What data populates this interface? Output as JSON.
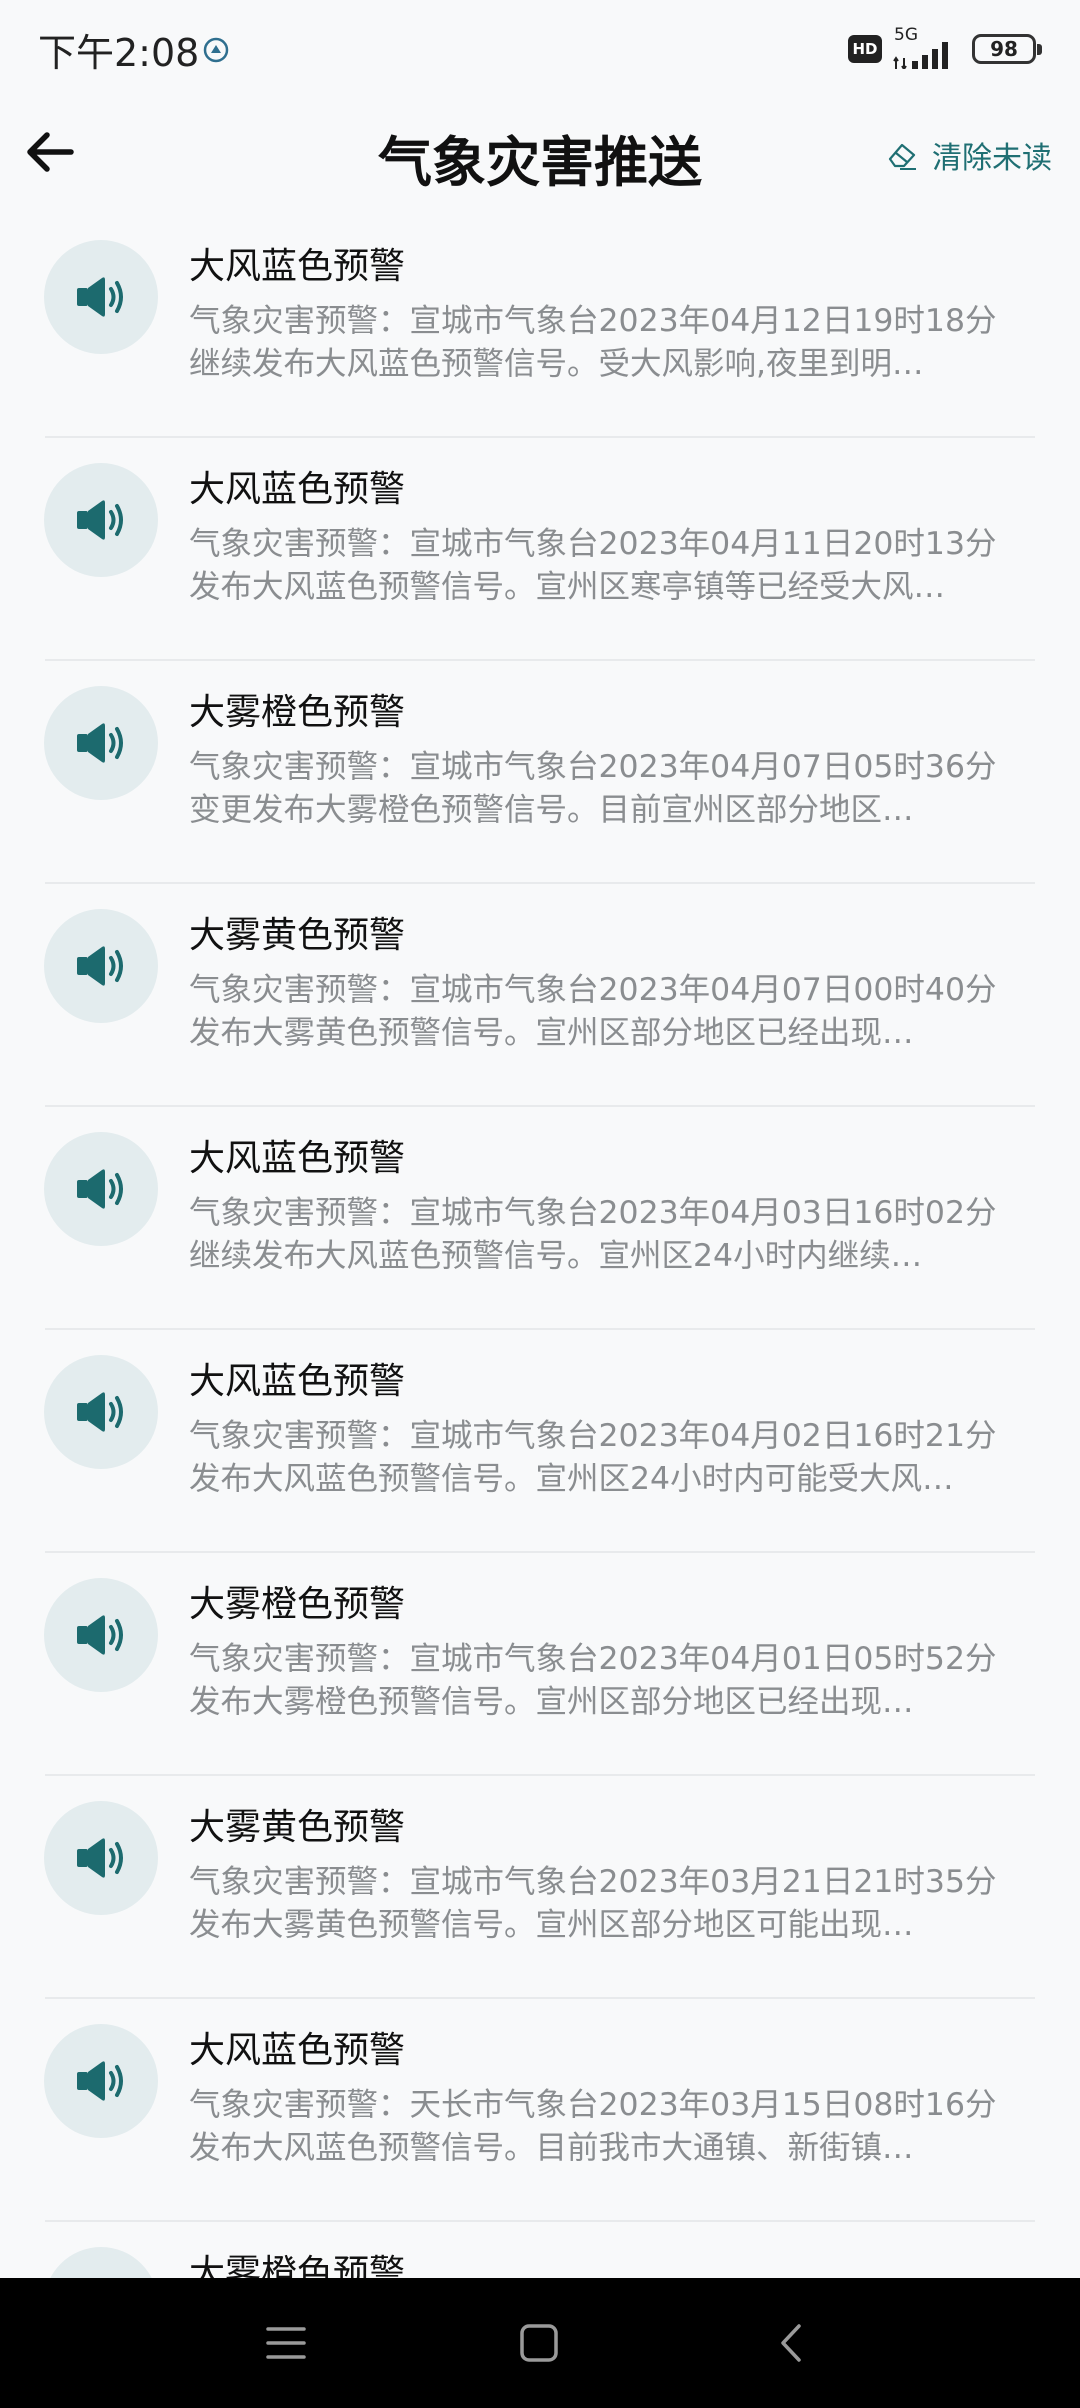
{
  "status_bar": {
    "time": "下午2:08",
    "hd_label": "HD",
    "network": "5G",
    "battery": "98"
  },
  "header": {
    "title": "气象灾害推送",
    "clear_unread_label": "清除未读"
  },
  "alerts": [
    {
      "title": "大风蓝色预警",
      "body": "气象灾害预警：宣城市气象台2023年04月12日19时18分继续发布大风蓝色预警信号。受大风影响,夜里到明…"
    },
    {
      "title": "大风蓝色预警",
      "body": "气象灾害预警：宣城市气象台2023年04月11日20时13分发布大风蓝色预警信号。宣州区寒亭镇等已经受大风…"
    },
    {
      "title": "大雾橙色预警",
      "body": "气象灾害预警：宣城市气象台2023年04月07日05时36分变更发布大雾橙色预警信号。目前宣州区部分地区…"
    },
    {
      "title": "大雾黄色预警",
      "body": "气象灾害预警：宣城市气象台2023年04月07日00时40分发布大雾黄色预警信号。宣州区部分地区已经出现…"
    },
    {
      "title": "大风蓝色预警",
      "body": "气象灾害预警：宣城市气象台2023年04月03日16时02分继续发布大风蓝色预警信号。宣州区24小时内继续…"
    },
    {
      "title": "大风蓝色预警",
      "body": "气象灾害预警：宣城市气象台2023年04月02日16时21分发布大风蓝色预警信号。宣州区24小时内可能受大风…"
    },
    {
      "title": "大雾橙色预警",
      "body": "气象灾害预警：宣城市气象台2023年04月01日05时52分发布大雾橙色预警信号。宣州区部分地区已经出现…"
    },
    {
      "title": "大雾黄色预警",
      "body": "气象灾害预警：宣城市气象台2023年03月21日21时35分发布大雾黄色预警信号。宣州区部分地区可能出现…"
    },
    {
      "title": "大风蓝色预警",
      "body": "气象灾害预警：天长市气象台2023年03月15日08时16分发布大风蓝色预警信号。目前我市大通镇、新街镇…"
    },
    {
      "title": "大雾橙色预警",
      "body": ""
    }
  ],
  "icons": {
    "alert_icon": "speaker-icon",
    "back": "arrow-left-icon",
    "clear": "eraser-icon",
    "nav_menu": "menu-icon",
    "nav_home": "home-icon",
    "nav_back": "chevron-left-icon"
  },
  "colors": {
    "accent": "#1f6f73",
    "icon_bg": "#e3ecee",
    "body_text": "#8a8d90",
    "background": "#f8f9fa"
  }
}
